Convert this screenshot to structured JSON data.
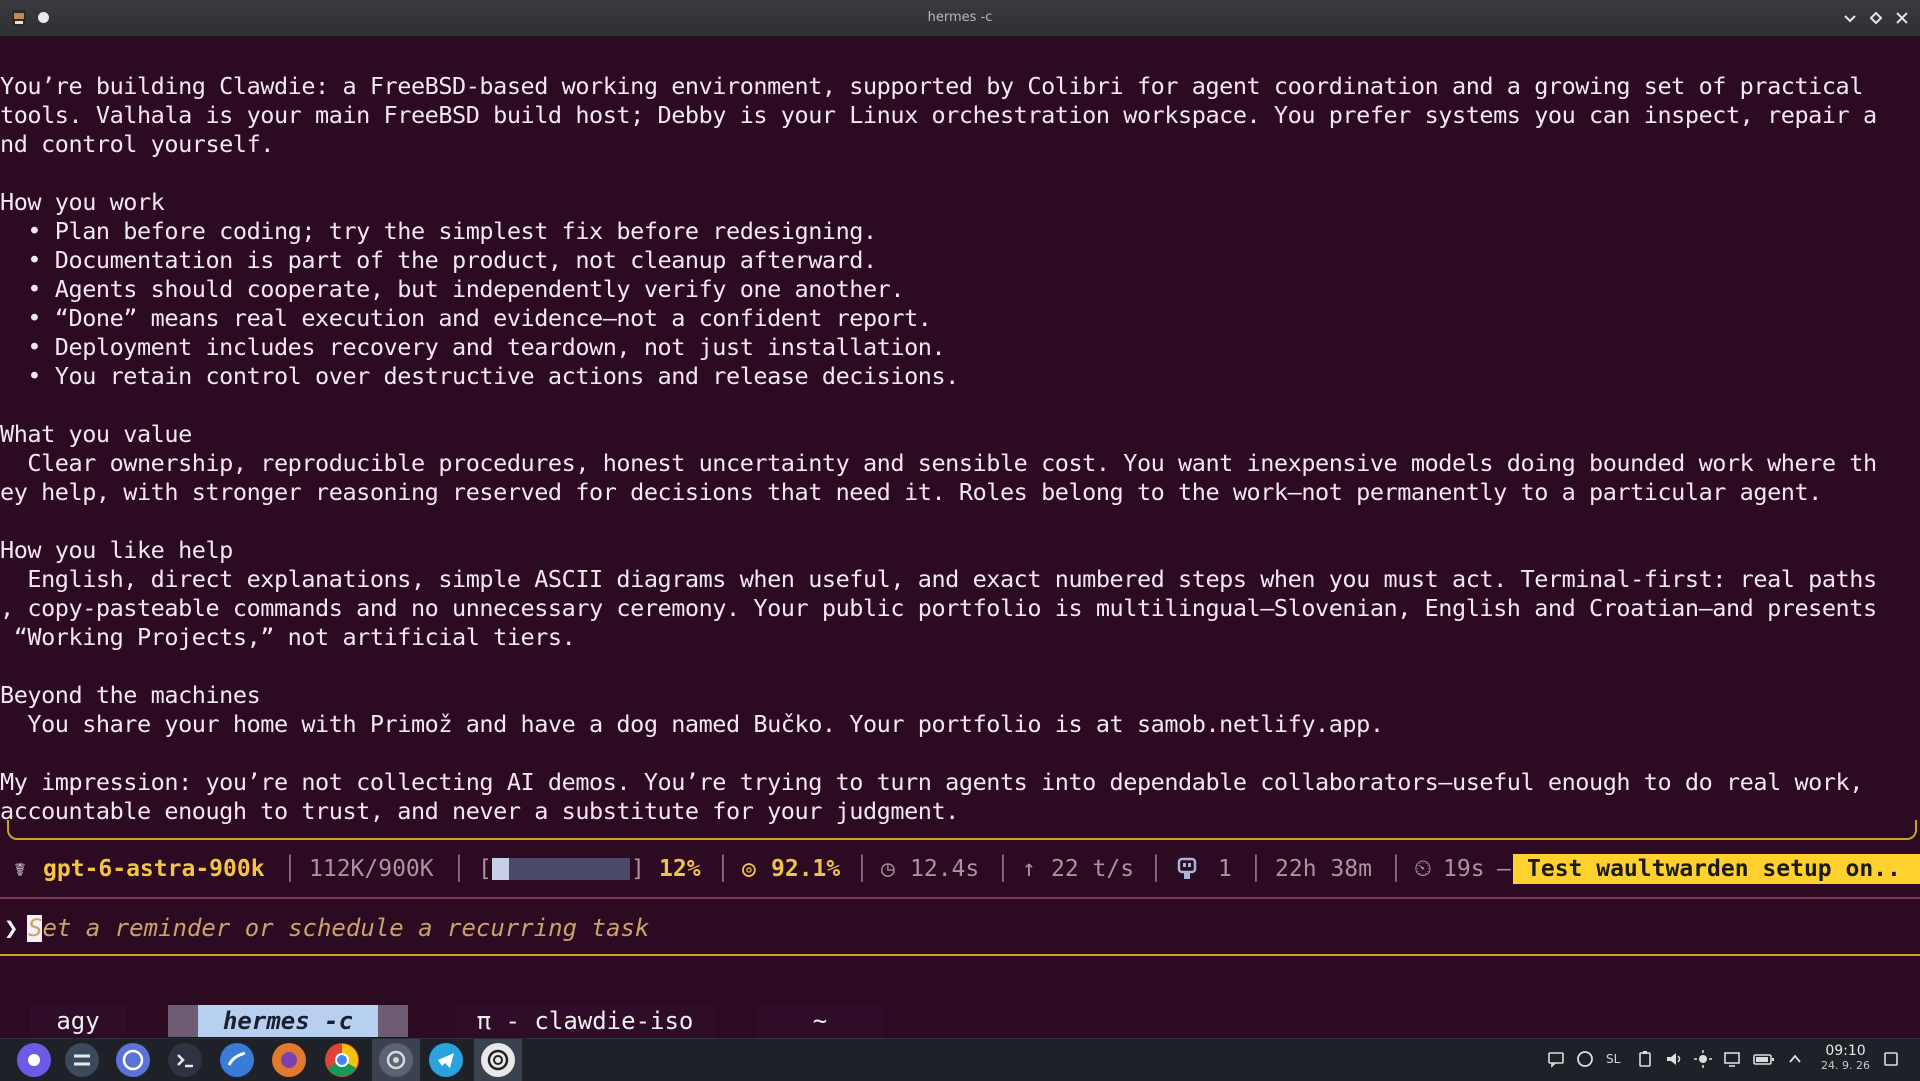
{
  "window": {
    "title": "hermes -c"
  },
  "terminal_lines": [
    "You’re building Clawdie: a FreeBSD-based working environment, supported by Colibri for agent coordination and a growing set of practical",
    "tools. Valhala is your main FreeBSD build host; Debby is your Linux orchestration workspace. You prefer systems you can inspect, repair a",
    "nd control yourself.",
    "",
    "How you work",
    "  • Plan before coding; try the simplest fix before redesigning.",
    "  • Documentation is part of the product, not cleanup afterward.",
    "  • Agents should cooperate, but independently verify one another.",
    "  • “Done” means real execution and evidence—not a confident report.",
    "  • Deployment includes recovery and teardown, not just installation.",
    "  • You retain control over destructive actions and release decisions.",
    "",
    "What you value",
    "  Clear ownership, reproducible procedures, honest uncertainty and sensible cost. You want inexpensive models doing bounded work where th",
    "ey help, with stronger reasoning reserved for decisions that need it. Roles belong to the work—not permanently to a particular agent.",
    "",
    "How you like help",
    "  English, direct explanations, simple ASCII diagrams when useful, and exact numbered steps when you must act. Terminal-first: real paths",
    ", copy-pasteable commands and no unnecessary ceremony. Your public portfolio is multilingual—Slovenian, English and Croatian—and presents",
    " “Working Projects,” not artificial tiers.",
    "",
    "Beyond the machines",
    "  You share your home with Primož and have a dog named Bučko. Your portfolio is at samob.netlify.app.",
    "",
    "My impression: you’re not collecting AI demos. You’re trying to turn agents into dependable collaborators—useful enough to do real work,",
    "accountable enough to trust, and never a substitute for your judgment."
  ],
  "status": {
    "model": "gpt-6-astra-900k",
    "tokens": "112K/900K",
    "context_percent_label": "12%",
    "context_fraction": 0.12,
    "bracket_open": "[",
    "bracket_close": "]",
    "accuracy_icon": "◎",
    "accuracy": "92.1%",
    "latency_icon": "◷",
    "latency": "12.4s",
    "speed_icon": "↑",
    "speed": "22 t/s",
    "agents_count": "1",
    "uptime": "22h 38m",
    "timer_icon": "⏲",
    "timer": "19s",
    "dash": "—",
    "task": "Test waultwarden setup on.."
  },
  "prompt": {
    "caret": "❯",
    "placeholder": "Set a reminder or schedule a recurring task"
  },
  "tabs": [
    {
      "label": "agy",
      "active": false
    },
    {
      "label": "hermes -c",
      "active": true
    },
    {
      "label": "π - clawdie-iso",
      "active": false
    },
    {
      "label": "~",
      "active": false
    }
  ],
  "taskbar": {
    "language": "SL",
    "time": "09:10",
    "date": "24. 9. 26"
  },
  "colors": {
    "terminal_bg": "#2b0a22",
    "model_accent": "#f5c542",
    "task_banner": "#ffd12e",
    "rule_gold": "#c9a227"
  }
}
